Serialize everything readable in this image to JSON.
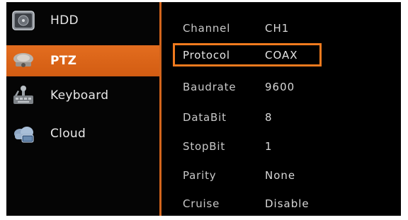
{
  "sidebar": {
    "items": [
      {
        "label": "HDD",
        "icon": "hdd-icon",
        "active": false
      },
      {
        "label": "PTZ",
        "icon": "ptz-camera-icon",
        "active": true
      },
      {
        "label": "Keyboard",
        "icon": "keyboard-icon",
        "active": false
      },
      {
        "label": "Cloud",
        "icon": "cloud-icon",
        "active": false
      }
    ]
  },
  "settings": {
    "rows": [
      {
        "name": "Channel",
        "value": "CH1"
      },
      {
        "name": "Protocol",
        "value": "COAX",
        "selected": true
      },
      {
        "name": "Baudrate",
        "value": "9600"
      },
      {
        "name": "DataBit",
        "value": "8"
      },
      {
        "name": "StopBit",
        "value": "1"
      },
      {
        "name": "Parity",
        "value": "None"
      },
      {
        "name": "Cruise",
        "value": "Disable"
      }
    ]
  },
  "colors": {
    "accent": "#d2641c",
    "highlight_border": "#f07a1e",
    "background": "#000000",
    "text": "#c8c8c8"
  }
}
